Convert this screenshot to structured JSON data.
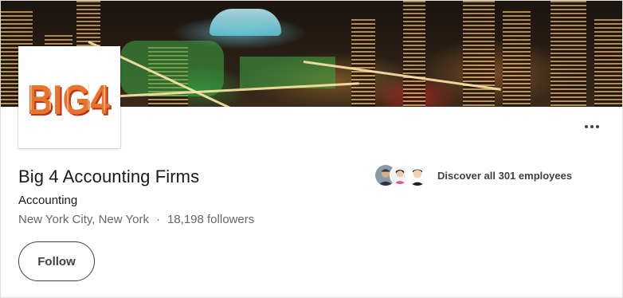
{
  "company": {
    "name": "Big 4 Accounting Firms",
    "industry": "Accounting",
    "location": "New York City, New York",
    "separator": "·",
    "followers": "18,198 followers",
    "logo_text": "BIG4"
  },
  "actions": {
    "follow_label": "Follow",
    "more_icon": "more-horizontal-icon"
  },
  "employees": {
    "label": "Discover all 301 employees"
  },
  "colors": {
    "logo_orange": "#e8732a",
    "logo_red": "#b8331d",
    "text_primary": "#191919",
    "text_secondary": "#666666"
  }
}
